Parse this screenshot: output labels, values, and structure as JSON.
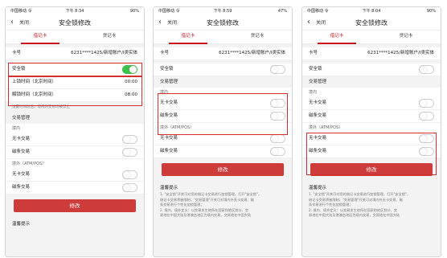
{
  "status": {
    "carrier": "中国移动 令",
    "p1_time": "下午 8:34",
    "p1_battery": "90%",
    "p2_time": "下午 8:59",
    "p2_battery": "47%",
    "p3_time": "下午 8:04",
    "p3_battery": "90%"
  },
  "nav": {
    "back_glyph": "‹",
    "close": "关闭",
    "title": "安全锁修改"
  },
  "tabs": {
    "debit": "借记卡",
    "credit": "贷记卡"
  },
  "card": {
    "label": "卡号",
    "value": "6231****1425/新增账户/I类实体"
  },
  "lock": {
    "label": "安全锁"
  },
  "phone1": {
    "unlock_label": "上锁时间（北京时间）",
    "unlock_value": "00:00",
    "lock_label": "解锁时间（北京时间）",
    "lock_value": "08:00",
    "note": "设置时间段后，境内外交易均被禁止"
  },
  "trade": {
    "section": "交易管理",
    "domestic": "境内",
    "cardless": "无卡交易",
    "magnetic": "磁条交易",
    "overseas": "境外（ATM/POS）"
  },
  "button": {
    "label": "修改"
  },
  "hints": {
    "title": "温馨提示",
    "lines": [
      "1. \"安全锁\"开关可对您的借记卡交易进行加锁管理，打开\"安全锁\"，",
      "   借记卡交易将被限制；\"交易管理\"开关可对境内外无卡交易、磁",
      "   条交易进行个性化加锁管理；",
      "2. 境内、境外定义：以交易发生地所在国家和地区划分，交",
      "   易地在中国大陆及港澳台地区为境内交易，交易地在中国大陆"
    ]
  },
  "phone3_hint_short": "温馨提示",
  "colors": {
    "accent": "#c9141e",
    "button": "#cd3b3b",
    "toggle_on": "#3bc24a",
    "highlight": "#d23030"
  }
}
